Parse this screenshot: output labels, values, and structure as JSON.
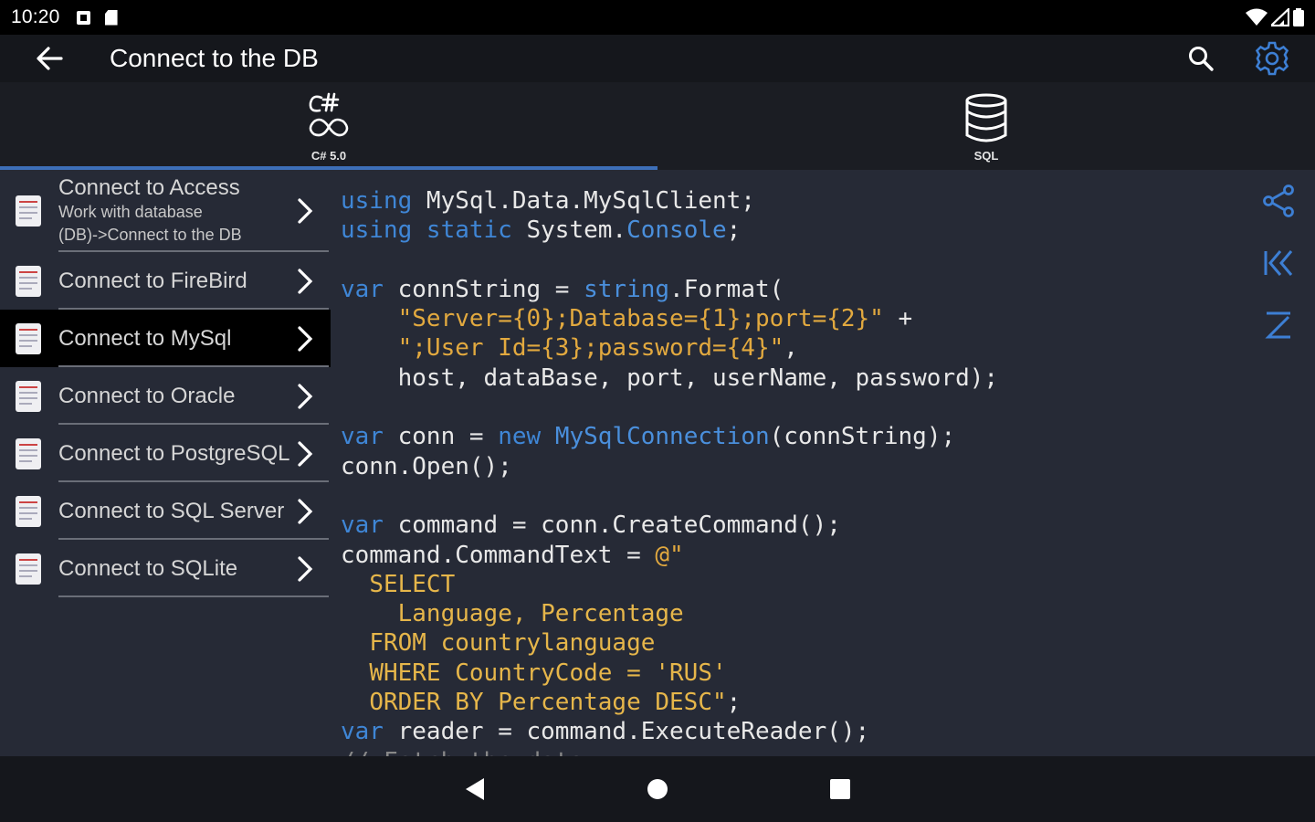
{
  "status_bar": {
    "time": "10:20"
  },
  "toolbar": {
    "title": "Connect to the DB"
  },
  "tabs": [
    {
      "label": "C# 5.0",
      "icon": "csharp-logo-icon"
    },
    {
      "label": "SQL",
      "icon": "database-icon"
    }
  ],
  "sidebar": {
    "items": [
      {
        "title": "Connect to Access",
        "sub1": "Work with database",
        "sub2": "(DB)->Connect to the DB"
      },
      {
        "title": "Connect to FireBird"
      },
      {
        "title": "Connect to MySql"
      },
      {
        "title": "Connect to Oracle"
      },
      {
        "title": "Connect to PostgreSQL"
      },
      {
        "title": "Connect to SQL Server"
      },
      {
        "title": "Connect to SQLite"
      }
    ]
  },
  "code": {
    "l1_kw": "using",
    "l1_rest": " MySql.Data.MySqlClient;",
    "l2_kw": "using static",
    "l2_mid": " System.",
    "l2_ty": "Console",
    "l2_end": ";",
    "l4_kw": "var",
    "l4_mid": " connString = ",
    "l4_ty": "string",
    "l4_end": ".Format(",
    "l5_str": "\"Server={0};Database={1};port={2}\"",
    "l5_end": " +",
    "l6_str": "\";User Id={3};password={4}\"",
    "l6_end": ",",
    "l7": "host, dataBase, port, userName, password);",
    "l9_kw": "var",
    "l9_mid": " conn = ",
    "l9_kw2": "new",
    "l9_ty": "MySqlConnection",
    "l9_end": "(connString);",
    "l10": "conn.Open();",
    "l12_kw": "var",
    "l12_rest": " command = conn.CreateCommand();",
    "l13_pre": "command.CommandText = ",
    "l13_str": "@\"",
    "l14": "SELECT",
    "l15": "Language, Percentage",
    "l16": "FROM countrylanguage",
    "l17": "WHERE CountryCode = 'RUS'",
    "l18_sql": "ORDER BY Percentage DESC\"",
    "l18_end": ";",
    "l19_kw": "var",
    "l19_rest": " reader = command.ExecuteReader();",
    "l20": "// Fetch the data"
  },
  "colors": {
    "accent": "#3d6fb8",
    "keyword": "#3f86d6",
    "string": "#e2a93f",
    "background": "#262a36"
  }
}
